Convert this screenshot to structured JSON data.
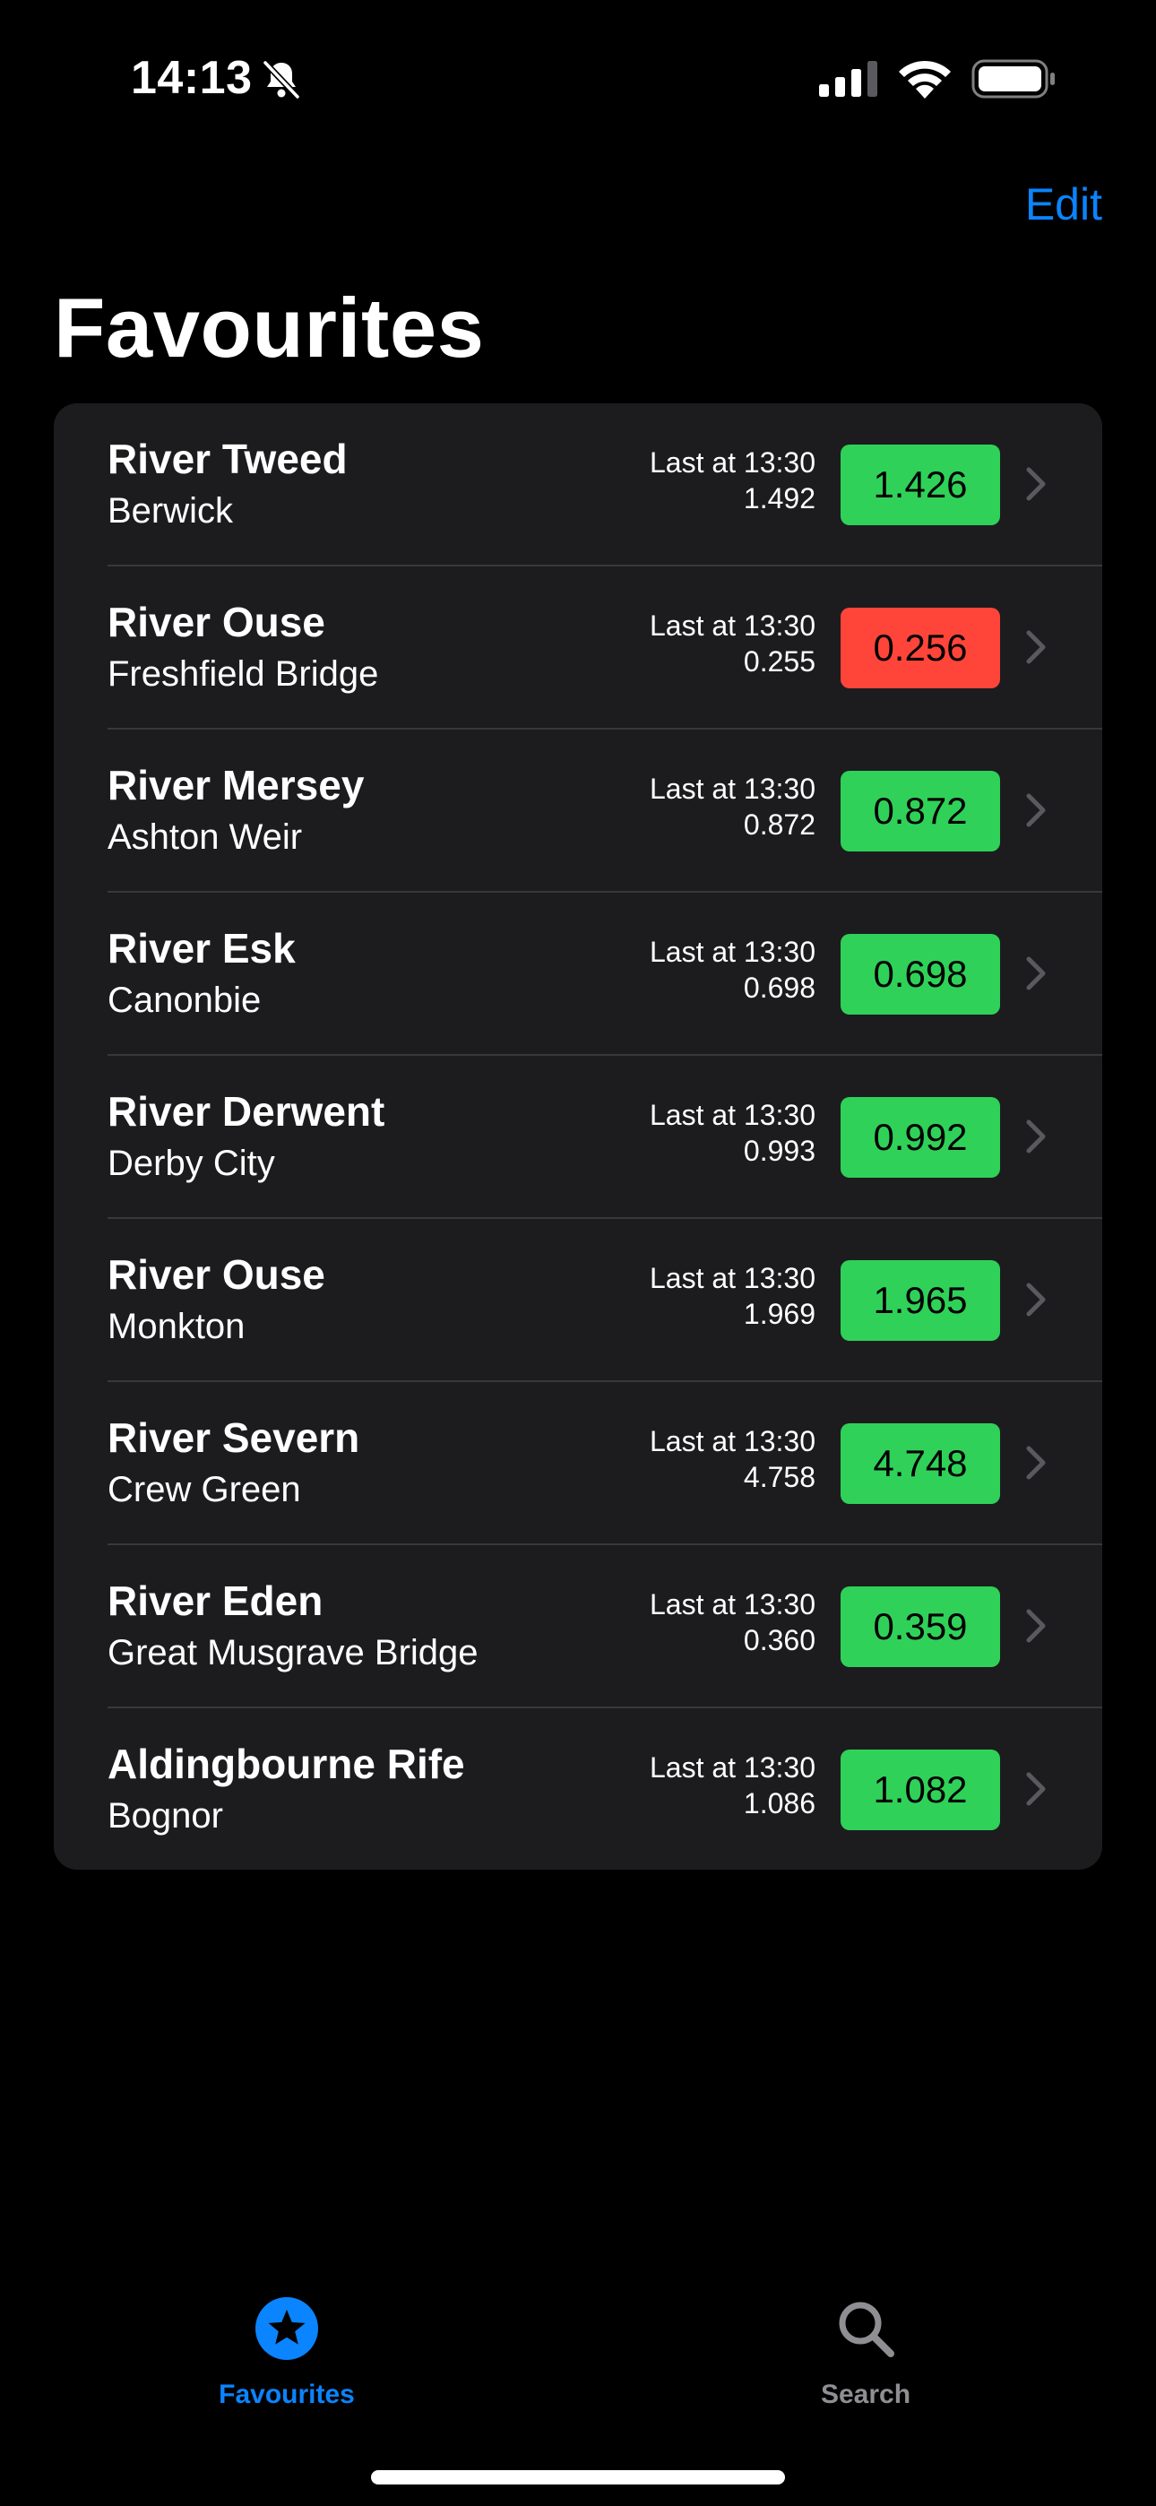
{
  "status_bar": {
    "time": "14:13",
    "icons": [
      "bell-slash-icon",
      "cellular-signal-icon",
      "wifi-icon",
      "battery-icon"
    ]
  },
  "nav": {
    "edit_label": "Edit",
    "title": "Favourites"
  },
  "colors": {
    "accent": "#0a84ff",
    "card_background": "#1c1c1e",
    "separator": "#38383a",
    "status_green": "#30d158",
    "status_red": "#ff453a",
    "tab_inactive": "#8e8e93"
  },
  "favourites": [
    {
      "river": "River Tweed",
      "station": "Berwick",
      "last_label": "Last at 13:30",
      "last_value": "1.492",
      "reading": "1.426",
      "status": "green"
    },
    {
      "river": "River Ouse",
      "station": "Freshfield Bridge",
      "last_label": "Last at 13:30",
      "last_value": "0.255",
      "reading": "0.256",
      "status": "red"
    },
    {
      "river": "River Mersey",
      "station": "Ashton Weir",
      "last_label": "Last at 13:30",
      "last_value": "0.872",
      "reading": "0.872",
      "status": "green"
    },
    {
      "river": "River Esk",
      "station": "Canonbie",
      "last_label": "Last at 13:30",
      "last_value": "0.698",
      "reading": "0.698",
      "status": "green"
    },
    {
      "river": "River Derwent",
      "station": "Derby City",
      "last_label": "Last at 13:30",
      "last_value": "0.993",
      "reading": "0.992",
      "status": "green"
    },
    {
      "river": "River Ouse",
      "station": "Monkton",
      "last_label": "Last at 13:30",
      "last_value": "1.969",
      "reading": "1.965",
      "status": "green"
    },
    {
      "river": "River Severn",
      "station": "Crew Green",
      "last_label": "Last at 13:30",
      "last_value": "4.758",
      "reading": "4.748",
      "status": "green"
    },
    {
      "river": "River Eden",
      "station": "Great Musgrave Bridge",
      "last_label": "Last at 13:30",
      "last_value": "0.360",
      "reading": "0.359",
      "status": "green"
    },
    {
      "river": "Aldingbourne Rife",
      "station": "Bognor",
      "last_label": "Last at 13:30",
      "last_value": "1.086",
      "reading": "1.082",
      "status": "green"
    }
  ],
  "tab_bar": {
    "tabs": [
      {
        "label": "Favourites",
        "icon": "star-icon",
        "selected": true
      },
      {
        "label": "Search",
        "icon": "search-icon",
        "selected": false
      }
    ]
  }
}
